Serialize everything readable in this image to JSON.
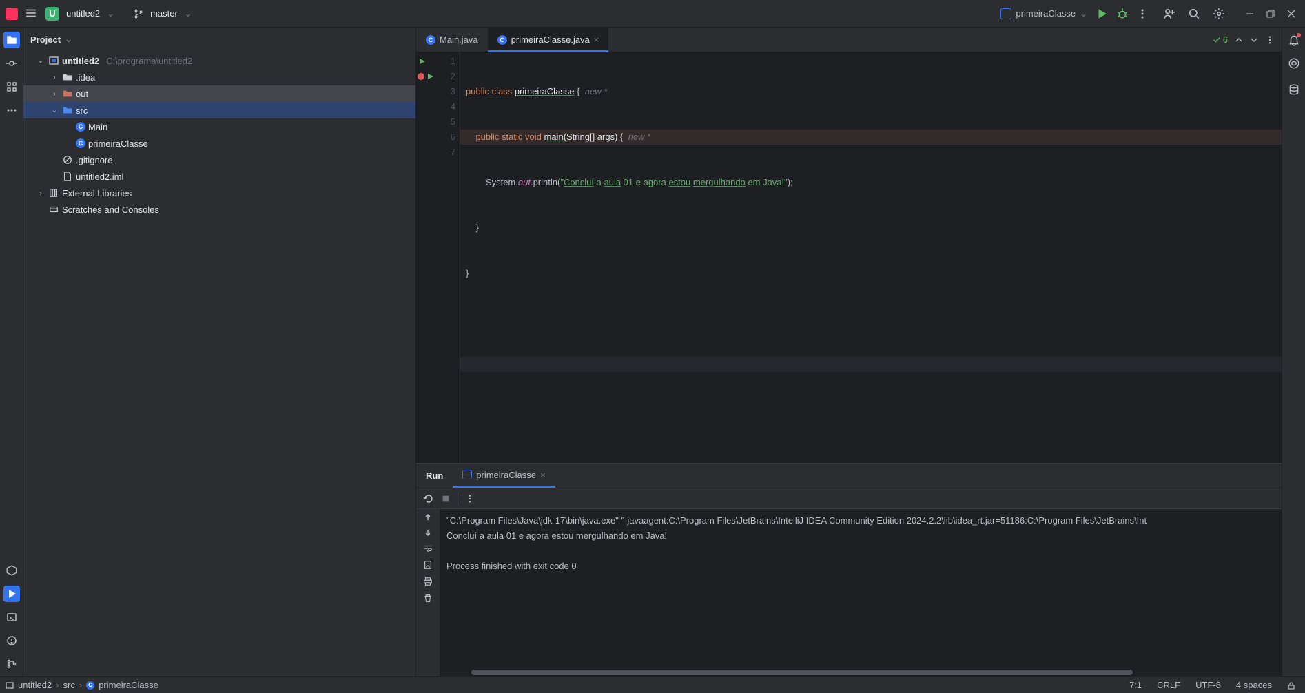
{
  "titlebar": {
    "project_name": "untitled2",
    "project_badge": "U",
    "branch": "master",
    "run_config": "primeiraClasse"
  },
  "project_panel": {
    "title": "Project",
    "tree": {
      "root": {
        "name": "untitled2",
        "path": "C:\\programa\\untitled2"
      },
      "idea": ".idea",
      "out": "out",
      "src": "src",
      "main_class": "Main",
      "primeira_class": "primeiraClasse",
      "gitignore": ".gitignore",
      "iml": "untitled2.iml",
      "ext_libs": "External Libraries",
      "scratches": "Scratches and Consoles"
    }
  },
  "tabs": {
    "main": "Main.java",
    "primeira": "primeiraClasse.java"
  },
  "inspections": {
    "count": "6"
  },
  "code_lines": {
    "l1_a": "public",
    "l1_b": "class",
    "l1_c": "primeiraClasse",
    "l1_d": "{",
    "l1_hint": "new *",
    "l2_a": "public",
    "l2_b": "static",
    "l2_c": "void",
    "l2_d": "main",
    "l2_e": "(String[] args) {",
    "l2_hint": "new *",
    "l3_a": "System.",
    "l3_b": "out",
    "l3_c": ".println(",
    "l3_d": "\"",
    "l3_e": "Concluí",
    "l3_f": " a ",
    "l3_g": "aula",
    "l3_h": " 01 e agora ",
    "l3_i": "estou",
    "l3_j": " ",
    "l3_k": "mergulhando",
    "l3_l": " em Java!\"",
    "l3_m": ");",
    "l4": "}",
    "l5": "}",
    "n1": "1",
    "n2": "2",
    "n3": "3",
    "n4": "4",
    "n5": "5",
    "n6": "6",
    "n7": "7"
  },
  "run": {
    "title": "Run",
    "config": "primeiraClasse",
    "out_cmd": "\"C:\\Program Files\\Java\\jdk-17\\bin\\java.exe\" \"-javaagent:C:\\Program Files\\JetBrains\\IntelliJ IDEA Community Edition 2024.2.2\\lib\\idea_rt.jar=51186:C:\\Program Files\\JetBrains\\Int",
    "out_line": "Concluí a aula 01 e agora estou mergulhando em Java!",
    "out_exit": "Process finished with exit code 0"
  },
  "breadcrumb": {
    "p1": "untitled2",
    "p2": "src",
    "p3": "primeiraClasse"
  },
  "statusbar": {
    "pos": "7:1",
    "eol": "CRLF",
    "enc": "UTF-8",
    "indent": "4 spaces"
  }
}
